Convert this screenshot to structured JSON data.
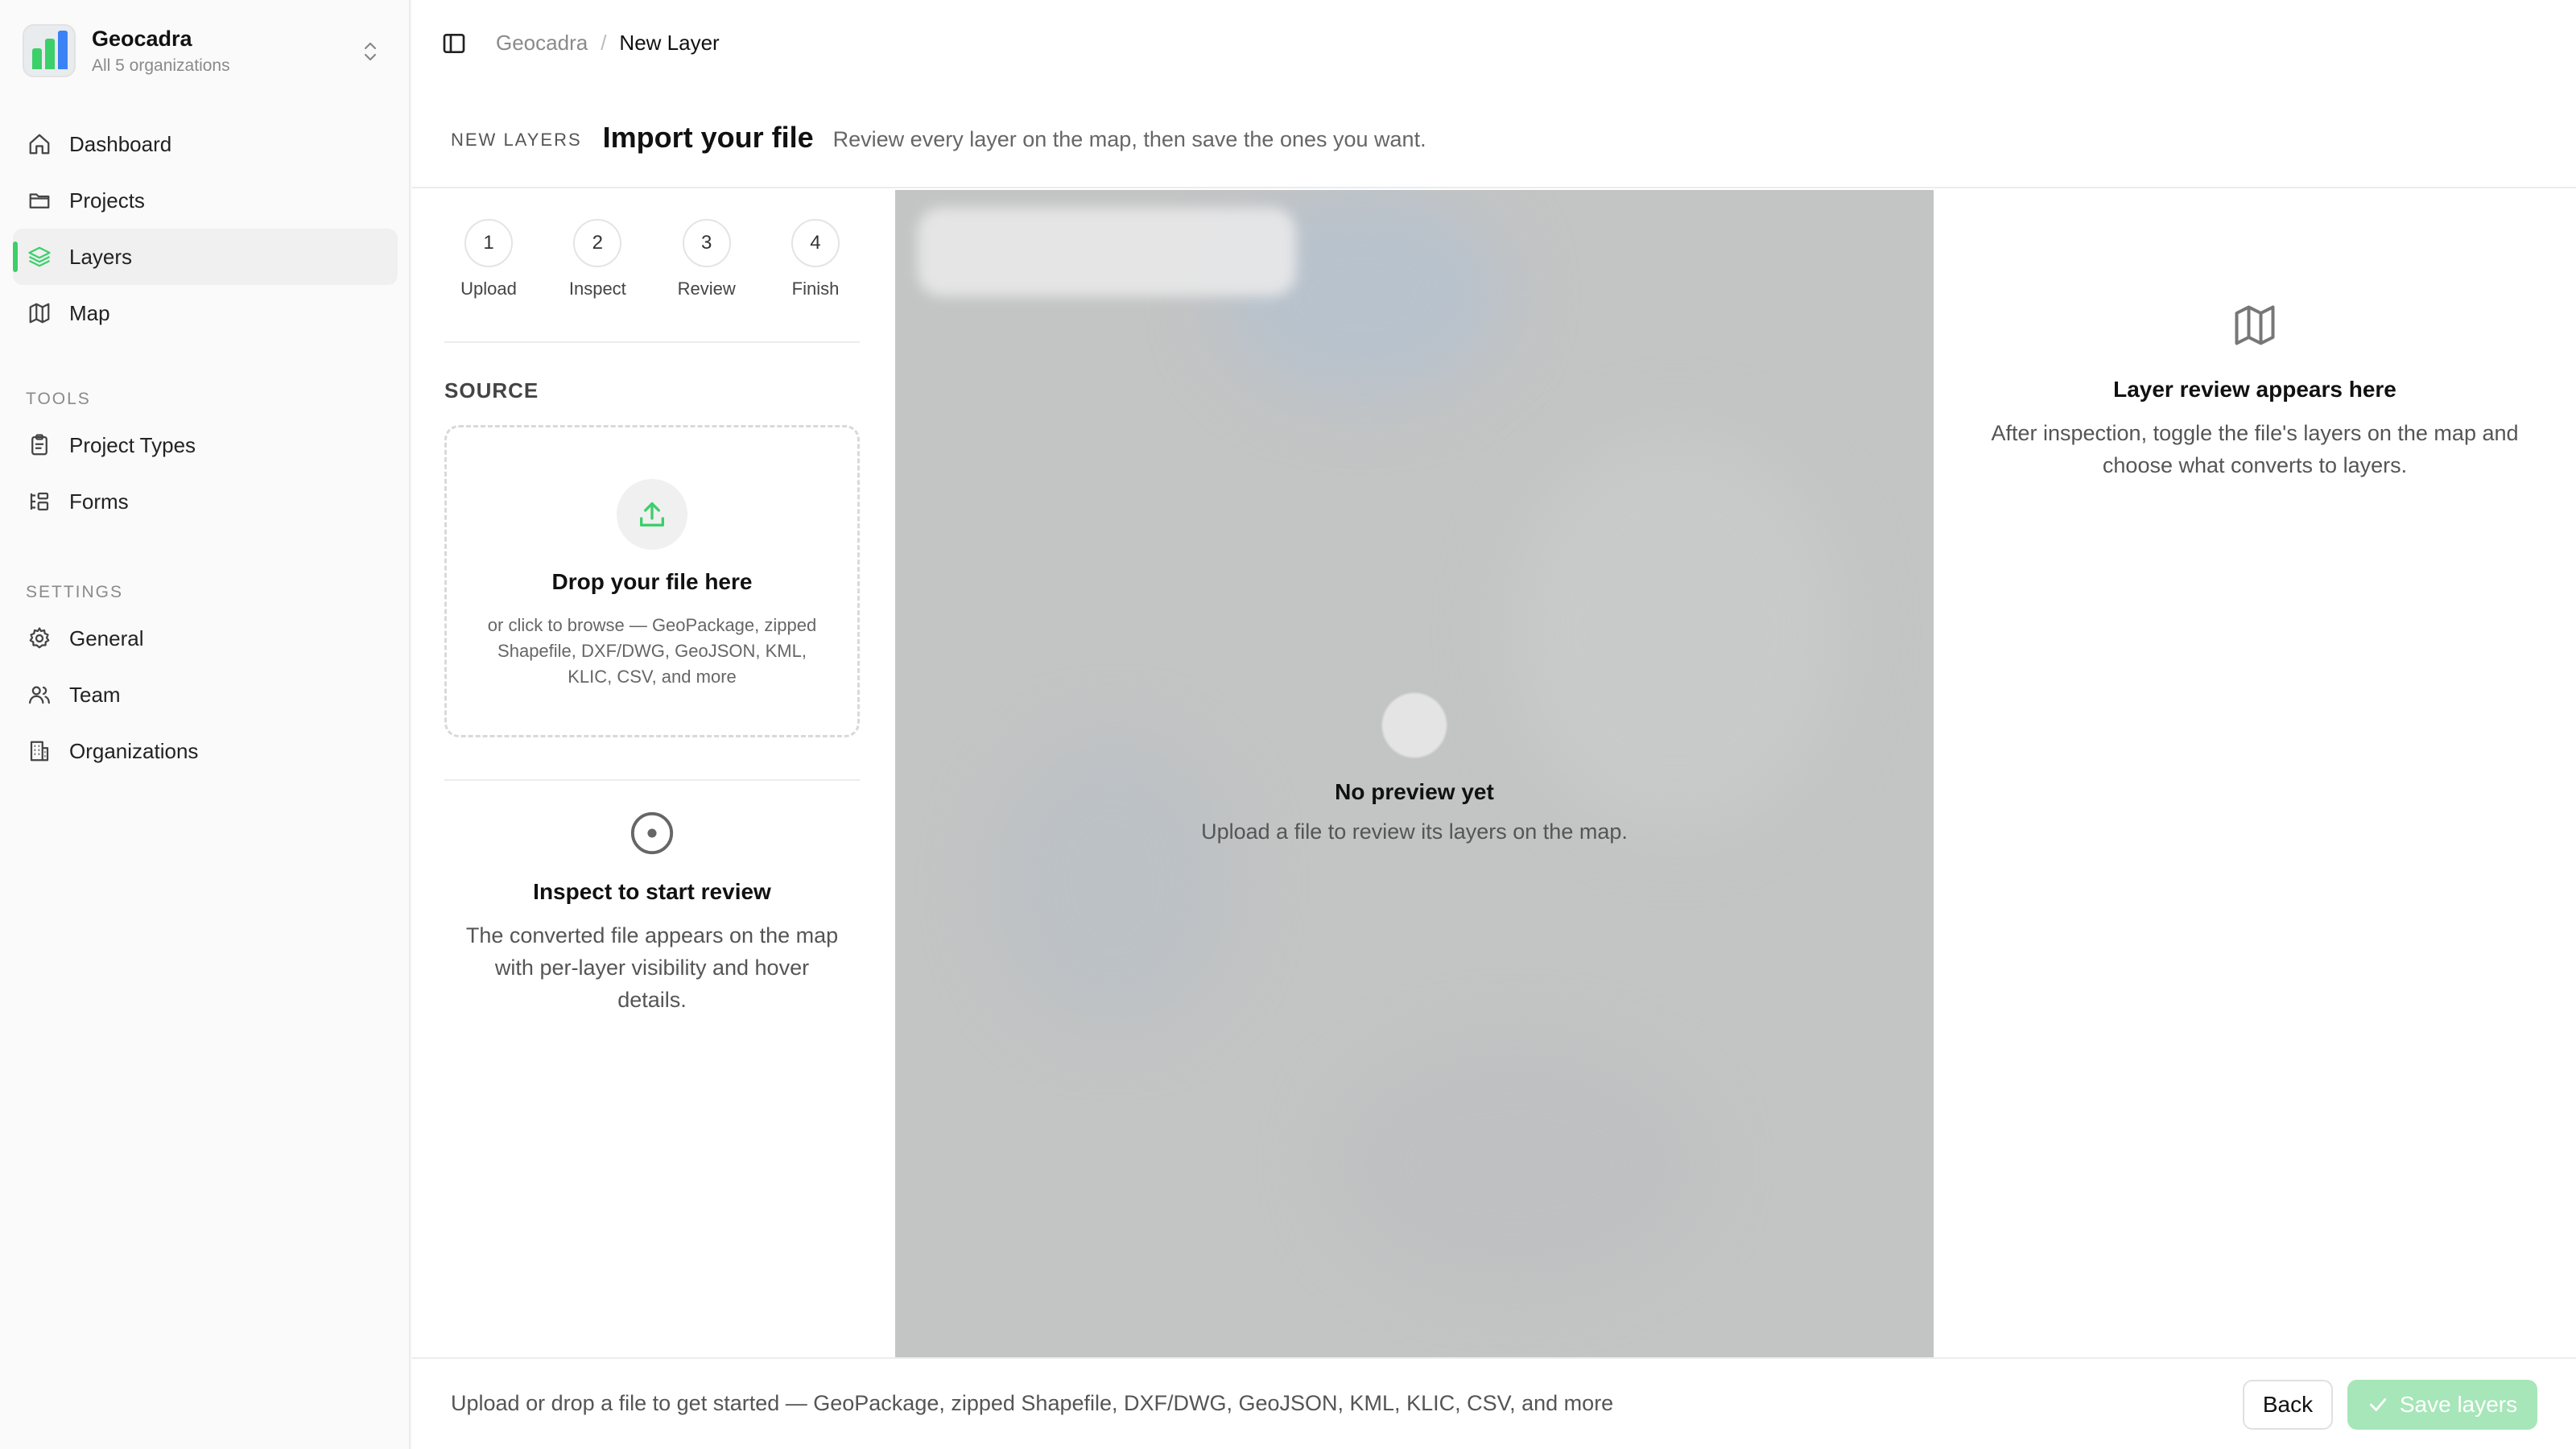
{
  "org": {
    "name": "Geocadra",
    "subtitle": "All 5 organizations",
    "logo_colors": [
      "#3ccf6a",
      "#3b82f6",
      "#60a5fa"
    ]
  },
  "sidebar": {
    "main_items": [
      {
        "label": "Dashboard",
        "icon": "home-icon",
        "active": false
      },
      {
        "label": "Projects",
        "icon": "folder-icon",
        "active": false
      },
      {
        "label": "Layers",
        "icon": "layers-icon",
        "active": true
      },
      {
        "label": "Map",
        "icon": "map-icon",
        "active": false
      }
    ],
    "tools_heading": "TOOLS",
    "tools_items": [
      {
        "label": "Project Types",
        "icon": "clipboard-icon"
      },
      {
        "label": "Forms",
        "icon": "form-icon"
      }
    ],
    "settings_heading": "SETTINGS",
    "settings_items": [
      {
        "label": "General",
        "icon": "gear-icon"
      },
      {
        "label": "Team",
        "icon": "users-icon"
      },
      {
        "label": "Organizations",
        "icon": "building-icon"
      }
    ]
  },
  "breadcrumb": {
    "root": "Geocadra",
    "separator": "/",
    "current": "New Layer"
  },
  "header": {
    "eyebrow": "NEW LAYERS",
    "title": "Import your file",
    "description": "Review every layer on the map, then save the ones you want."
  },
  "stepper": [
    {
      "number": "1",
      "label": "Upload"
    },
    {
      "number": "2",
      "label": "Inspect"
    },
    {
      "number": "3",
      "label": "Review"
    },
    {
      "number": "4",
      "label": "Finish"
    }
  ],
  "source": {
    "label": "SOURCE",
    "dropzone_title": "Drop your file here",
    "dropzone_desc": "or click to browse — GeoPackage, zipped Shapefile, DXF/DWG, GeoJSON, KML, KLIC, CSV, and more"
  },
  "inspect": {
    "title": "Inspect to start review",
    "description": "The converted file appears on the map with per-layer visibility and hover details."
  },
  "map": {
    "empty_title": "No preview yet",
    "empty_desc": "Upload a file to review its layers on the map."
  },
  "review_panel": {
    "title": "Layer review appears here",
    "description": "After inspection, toggle the file's layers on the map and choose what converts to layers."
  },
  "footer": {
    "hint": "Upload or drop a file to get started — GeoPackage, zipped Shapefile, DXF/DWG, GeoJSON, KML, KLIC, CSV, and more",
    "back_label": "Back",
    "save_label": "Save layers"
  },
  "colors": {
    "accent": "#3ccf6a",
    "save_disabled": "#a6e6b8",
    "map_bg": "#c3c4c4"
  }
}
